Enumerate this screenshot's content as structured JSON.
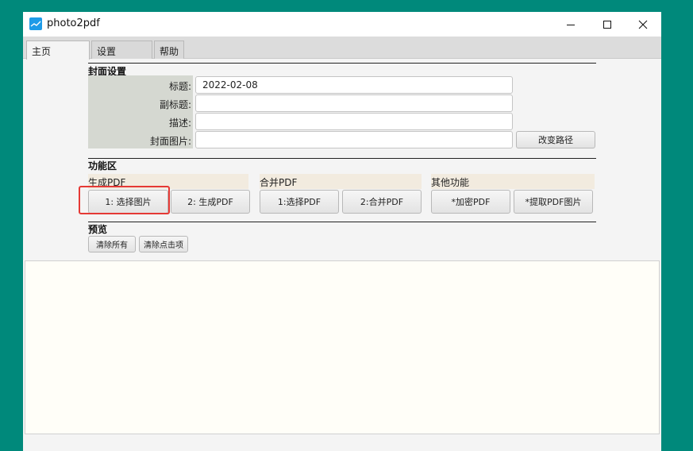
{
  "window": {
    "title": "photo2pdf",
    "controls": {
      "minimize": "minimize-icon",
      "maximize": "maximize-icon",
      "close": "close-icon"
    }
  },
  "tabs": [
    {
      "label": "主页",
      "active": true
    },
    {
      "label": "设置",
      "active": false
    },
    {
      "label": "帮助",
      "active": false
    }
  ],
  "cover": {
    "section_title": "封面设置",
    "title_label": "标题:",
    "title_value": "2022-02-08",
    "subtitle_label": "副标题:",
    "subtitle_value": "",
    "desc_label": "描述:",
    "desc_value": "",
    "image_label": "封面图片:",
    "image_value": "",
    "change_path_button": "改变路径"
  },
  "functions": {
    "section_title": "功能区",
    "generate": {
      "header": "生成PDF",
      "select_images_button": "1: 选择图片",
      "generate_button": "2: 生成PDF"
    },
    "merge": {
      "header": "合并PDF",
      "select_pdf_button": "1:选择PDF",
      "merge_button": "2:合并PDF"
    },
    "other": {
      "header": "其他功能",
      "encrypt_button": "*加密PDF",
      "extract_button": "*提取PDF图片"
    }
  },
  "preview": {
    "section_title": "预览",
    "clear_all_button": "清除所有",
    "clear_clicked_button": "清除点击项"
  },
  "colors": {
    "desktop": "#00897b",
    "highlight": "#e53935",
    "app_icon": "#1e9be8"
  }
}
